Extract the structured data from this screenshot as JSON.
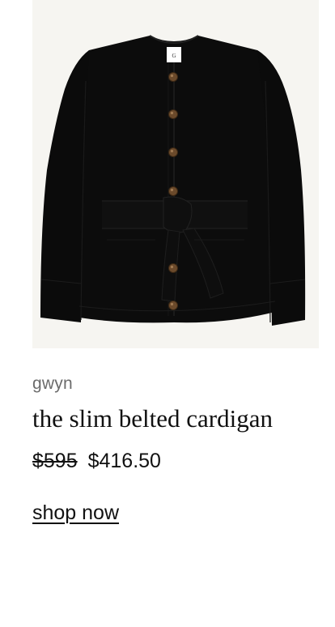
{
  "product": {
    "brand": "gwyn",
    "name": "the slim belted cardigan",
    "price_original": "$595",
    "price_sale": "$416.50",
    "cta_label": "shop now",
    "image_label": "G"
  },
  "colors": {
    "image_background": "#f6f5f1",
    "garment": "#0c0c0c",
    "button": "#6b4a2b",
    "brand_text": "#6b6b6b",
    "text": "#111111"
  },
  "icons": {
    "garment": "cardigan-image"
  }
}
